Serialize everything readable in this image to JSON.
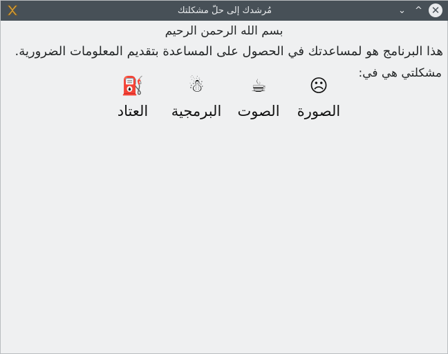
{
  "window": {
    "title": "مُرشدك إلى حلّ مشكلتك",
    "buttons": {
      "minimize": "⌄",
      "maximize": "^",
      "close": "✕"
    }
  },
  "main": {
    "basmala": "بسم الله الرحمن الرحيم",
    "description": "هذا البرنامج هو لمساعدتك في الحصول على المساعدة بتقديم المعلومات الضرورية.",
    "question": "مشكلتي هي في:",
    "options": [
      {
        "icon": "sad-face-icon",
        "glyph": "☹",
        "label": "الصورة"
      },
      {
        "icon": "hot-beverage-icon",
        "glyph": "☕",
        "label": "الصوت"
      },
      {
        "icon": "snowman-icon",
        "glyph": "☃",
        "label": "البرمجية"
      },
      {
        "icon": "fuel-pump-icon",
        "glyph": "⛽",
        "label": "العتاد"
      }
    ]
  }
}
